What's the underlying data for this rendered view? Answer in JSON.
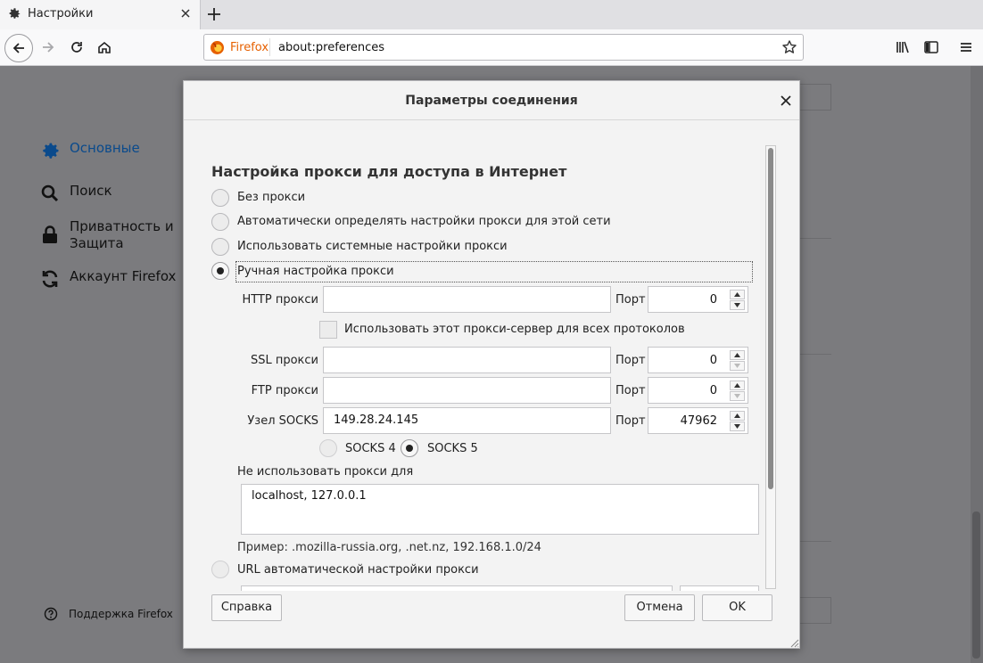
{
  "tab": {
    "title": "Настройки"
  },
  "urlbar": {
    "identity": "Firefox",
    "url": "about:preferences"
  },
  "sidebar": {
    "items": [
      {
        "label": "Основные",
        "icon": "gear-icon"
      },
      {
        "label": "Поиск",
        "icon": "search-icon"
      },
      {
        "label": "Приватность и Защита",
        "icon": "lock-icon"
      },
      {
        "label": "Аккаунт Firefox",
        "icon": "sync-icon"
      }
    ],
    "support": "Поддержка Firefox"
  },
  "dialog": {
    "title": "Параметры соединения",
    "section_title": "Настройка прокси для доступа в Интернет",
    "options": {
      "no_proxy": "Без прокси",
      "auto_detect": "Автоматически определять настройки прокси для этой сети",
      "system": "Использовать системные настройки прокси",
      "manual": "Ручная настройка прокси",
      "auto_url": "URL автоматической настройки прокси"
    },
    "selected_option": "manual",
    "http": {
      "label": "HTTP прокси",
      "value": "",
      "port_label": "Порт",
      "port": "0"
    },
    "share_checkbox": {
      "label": "Использовать этот прокси-сервер для всех протоколов",
      "checked": false
    },
    "ssl": {
      "label": "SSL прокси",
      "value": "",
      "port_label": "Порт",
      "port": "0"
    },
    "ftp": {
      "label": "FTP прокси",
      "value": "",
      "port_label": "Порт",
      "port": "0"
    },
    "socks": {
      "label": "Узел SOCKS",
      "value": "149.28.24.145",
      "port_label": "Порт",
      "port": "47962"
    },
    "socks_versions": {
      "v4": "SOCKS 4",
      "v5": "SOCKS 5",
      "selected": "v5"
    },
    "no_proxy_for": {
      "label": "Не использовать прокси для",
      "value": "localhost, 127.0.0.1"
    },
    "example": "Пример: .mozilla-russia.org, .net.nz, 192.168.1.0/24",
    "buttons": {
      "help": "Справка",
      "cancel": "Отмена",
      "ok": "OK"
    }
  },
  "colors": {
    "accent": "#0a4a8c",
    "firefox_orange": "#e66000"
  }
}
